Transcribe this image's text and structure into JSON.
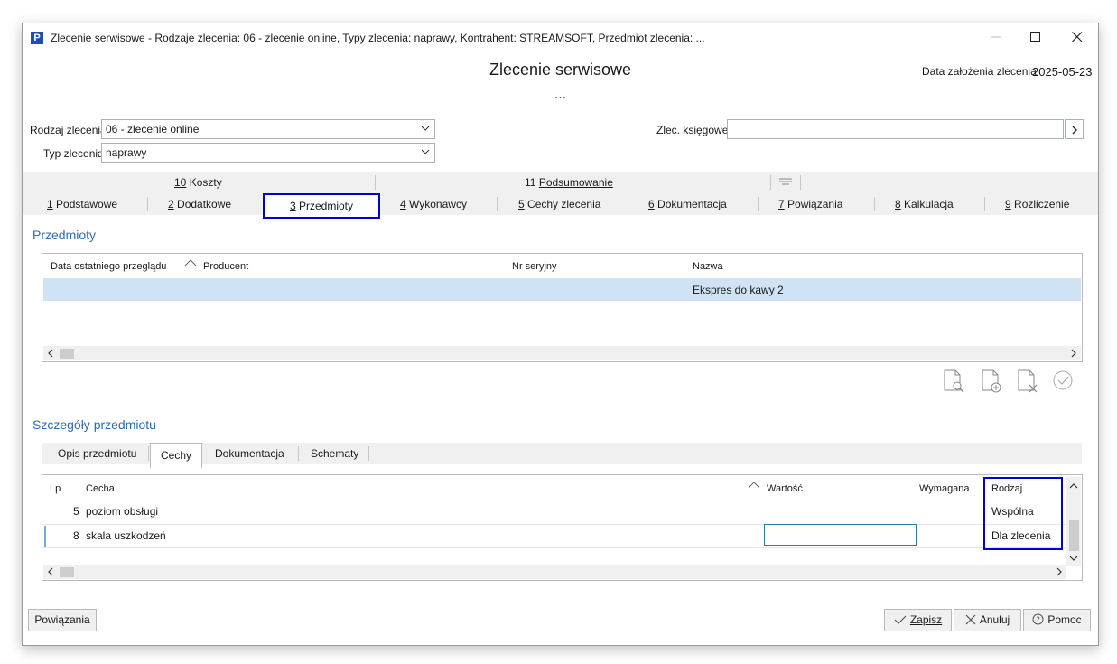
{
  "window": {
    "title": "Zlecenie serwisowe - Rodzaje zlecenia: 06 - zlecenie online, Typy zlecenia: naprawy, Kontrahent: STREAMSOFT, Przedmiot zlecenia: ..."
  },
  "header": {
    "title": "Zlecenie serwisowe",
    "subtitle": "...",
    "date_label": "Data założenia zlecenia:",
    "date_value": "2025-05-23"
  },
  "form": {
    "rodzaj_label": "Rodzaj zlecenia",
    "rodzaj_value": "06 - zlecenie online",
    "typ_label": "Typ zlecenia",
    "typ_value": "naprawy",
    "zlec_label": "Zlec. księgowe",
    "zlec_value": ""
  },
  "tabs_top": [
    {
      "num": "10",
      "label": "Koszty"
    },
    {
      "num": "11",
      "label": "Podsumowanie"
    }
  ],
  "tabs": [
    {
      "num": "1",
      "label": "Podstawowe"
    },
    {
      "num": "2",
      "label": "Dodatkowe"
    },
    {
      "num": "3",
      "label": "Przedmioty"
    },
    {
      "num": "4",
      "label": "Wykonawcy"
    },
    {
      "num": "5",
      "label": "Cechy zlecenia"
    },
    {
      "num": "6",
      "label": "Dokumentacja"
    },
    {
      "num": "7",
      "label": "Powiązania"
    },
    {
      "num": "8",
      "label": "Kalkulacja"
    },
    {
      "num": "9",
      "label": "Rozliczenie"
    }
  ],
  "przedmioty": {
    "title": "Przedmioty",
    "columns": [
      "Data ostatniego przeglądu",
      "Producent",
      "Nr seryjny",
      "Nazwa"
    ],
    "rows": [
      {
        "data": "",
        "producent": "",
        "nr": "",
        "nazwa": "Ekspres do kawy 2"
      }
    ]
  },
  "szczegoly": {
    "title": "Szczegóły przedmiotu",
    "subtabs": [
      "Opis przedmiotu",
      "Cechy",
      "Dokumentacja",
      "Schematy"
    ],
    "columns": [
      "Lp",
      "Cecha",
      "Wartość",
      "Wymagana",
      "Rodzaj"
    ],
    "rows": [
      {
        "lp": "5",
        "cecha": "poziom obsługi",
        "wartosc": "",
        "wymagana": "",
        "rodzaj": "Wspólna"
      },
      {
        "lp": "8",
        "cecha": "skala uszkodzeń",
        "wartosc": "",
        "wymagana": "",
        "rodzaj": "Dla zlecenia"
      }
    ]
  },
  "footer": {
    "powiazania": "Powiązania",
    "zapisz": "Zapisz",
    "anuluj": "Anuluj",
    "pomoc": "Pomoc"
  },
  "colors": {
    "accent": "#2d6cb4",
    "highlight_border": "#0000d0",
    "selected_row": "#cfe3f4"
  }
}
